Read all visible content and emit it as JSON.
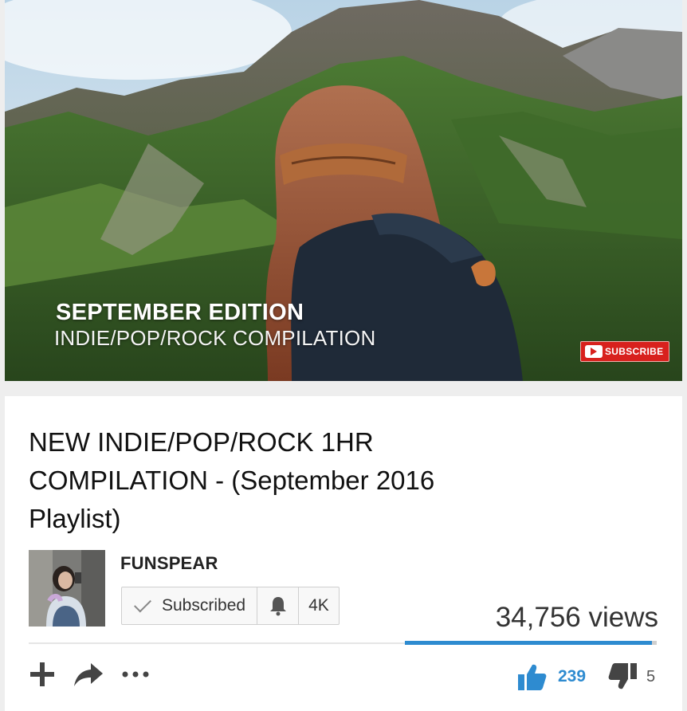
{
  "player": {
    "overlay_title": "SEPTEMBER EDITION",
    "overlay_subtitle": "INDIE/POP/ROCK COMPILATION",
    "subscribe_watermark": "SUBSCRIBE"
  },
  "video": {
    "title": "NEW INDIE/POP/ROCK 1HR COMPILATION - (September 2016 Playlist)",
    "views": "34,756 views"
  },
  "channel": {
    "name": "FUNSPEAR",
    "subscribe_label": "Subscribed",
    "subscriber_count": "4K"
  },
  "ratings": {
    "likes": "239",
    "dislikes": "5",
    "like_ratio": 0.98
  },
  "icons": [
    "add-to-playlist-icon",
    "share-icon",
    "more-icon",
    "bell-icon",
    "check-icon",
    "thumbs-up-icon",
    "thumbs-down-icon",
    "play-icon"
  ],
  "colors": {
    "accent_blue": "#2e8bd0",
    "youtube_red": "#d8211d"
  }
}
